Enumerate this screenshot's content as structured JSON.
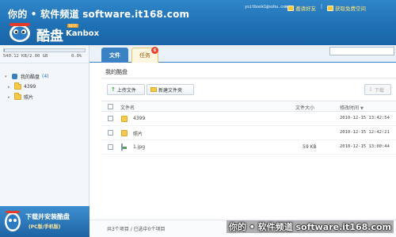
{
  "header": {
    "watermark": "你的 • 软件频道 software.it168.com",
    "logo_cn": "酷盘",
    "logo_beta": "BETA",
    "logo_en": "Kanbox",
    "user_email": "ysitbook1@sohu.com",
    "invite_label": "邀请好友",
    "sep": "|",
    "free_space_label": "获取免费空间"
  },
  "sidebar": {
    "storage_text": "540.12 KB/2.00 GB",
    "storage_percent_text": "0.0%",
    "storage_fraction": 0.0003,
    "tree": {
      "root_label": "我的酷盘",
      "root_count": "(4)",
      "children": [
        {
          "label": "4399"
        },
        {
          "label": "照片"
        }
      ]
    },
    "promo": {
      "line1": "下载并安装酷盘",
      "line2": "(PC版/手机版)"
    }
  },
  "main": {
    "tabs": {
      "files": "文件",
      "tasks": "任务",
      "tasks_badge": "6"
    },
    "breadcrumb": "我的酷盘",
    "toolbar": {
      "upload": "上传文件",
      "new_folder": "新建文件夹",
      "download": "下载"
    },
    "columns": {
      "name": "文件名",
      "size": "文件大小",
      "date": "修改时间",
      "date_sort": "▼"
    },
    "rows": [
      {
        "name": "4399",
        "size": "",
        "date": "2010-12-15 13:42:54",
        "type": "folder"
      },
      {
        "name": "照片",
        "size": "",
        "date": "2010-12-15 12:42:21",
        "type": "folder"
      },
      {
        "name": "1.jpg",
        "size": "59 KB",
        "date": "2010-12-15 13:00:44",
        "type": "image"
      }
    ],
    "status": "共3个项目 / 已选中0个项目",
    "watermark_bottom": "你的 • 软件频道 software.it168.com"
  },
  "colors": {
    "header_blue": "#1e6fb3",
    "accent_blue": "#3b82c4",
    "folder_yellow": "#f5c94a",
    "badge_red": "#e8442e"
  }
}
